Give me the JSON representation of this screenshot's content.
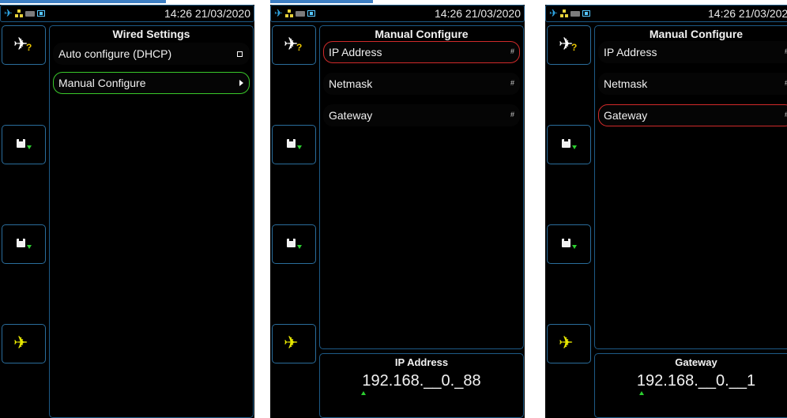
{
  "status_bar": {
    "time_date": "14:26 21/03/2020"
  },
  "side_buttons": [
    {
      "icon": "airplane-question-icon"
    },
    {
      "icon": "save-down-icon"
    },
    {
      "icon": "save-down-icon"
    },
    {
      "icon": "airplane-icon"
    }
  ],
  "screen1": {
    "title": "Wired Settings",
    "items": [
      {
        "label": "Auto configure (DHCP)"
      },
      {
        "label": "Manual Configure"
      }
    ]
  },
  "screen2": {
    "title": "Manual Configure",
    "items": [
      {
        "label": "IP Address",
        "indicator": "#"
      },
      {
        "label": "Netmask",
        "indicator": "#"
      },
      {
        "label": "Gateway",
        "indicator": "#"
      }
    ],
    "editor": {
      "title": "IP Address",
      "value": "192.168.__0._88"
    }
  },
  "screen3": {
    "title": "Manual Configure",
    "items": [
      {
        "label": "IP Address",
        "indicator": "#"
      },
      {
        "label": "Netmask",
        "indicator": "#"
      },
      {
        "label": "Gateway",
        "indicator": "#"
      }
    ],
    "editor": {
      "title": "Gateway",
      "value": "192.168.__0.__1"
    }
  },
  "colors": {
    "background": "#000000",
    "panel_border": "#1d5a86",
    "selected_green": "#39c92a",
    "selected_red": "#d02a2a",
    "plane_yellow": "#e6e600"
  }
}
